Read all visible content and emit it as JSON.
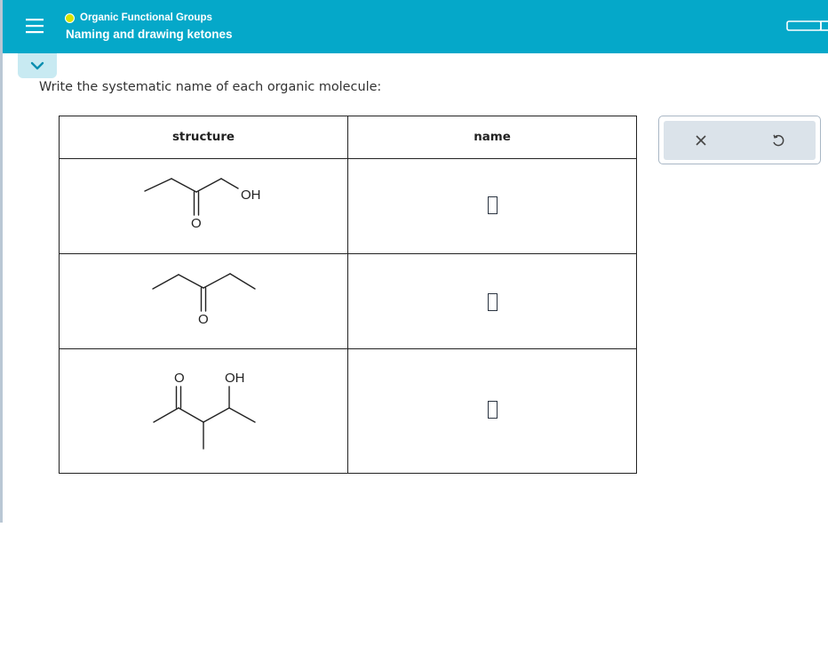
{
  "header": {
    "topic": "Organic Functional Groups",
    "title": "Naming and drawing ketones",
    "topic_status_color": "#d7e400",
    "bar_color": "#05a8c9"
  },
  "icons": {
    "menu": "hamburger-menu-icon",
    "collapse": "chevron-down-icon",
    "battery": "battery-icon",
    "clear": "close-icon",
    "undo": "undo-icon"
  },
  "instruction": "Write the systematic name of each organic molecule:",
  "table": {
    "headers": [
      "structure",
      "name"
    ],
    "rows": [
      {
        "labels": [
          "OH",
          "O"
        ],
        "answer": ""
      },
      {
        "labels": [
          "O"
        ],
        "answer": ""
      },
      {
        "labels": [
          "O",
          "OH"
        ],
        "answer": ""
      }
    ]
  }
}
